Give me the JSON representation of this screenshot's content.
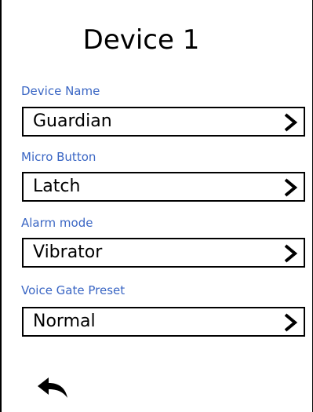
{
  "screen": {
    "title": "Device 1"
  },
  "fields": [
    {
      "label": "Device Name",
      "value": "Guardian"
    },
    {
      "label": "Micro Button",
      "value": "Latch"
    },
    {
      "label": "Alarm mode",
      "value": "Vibrator"
    },
    {
      "label": "Voice Gate Preset",
      "value": "Normal"
    }
  ],
  "icons": {
    "chevron": "chevron-right-icon",
    "back": "back-arrow-icon"
  },
  "colors": {
    "label": "#3a66c4",
    "text": "#000000",
    "border": "#000000",
    "background": "#ffffff"
  }
}
